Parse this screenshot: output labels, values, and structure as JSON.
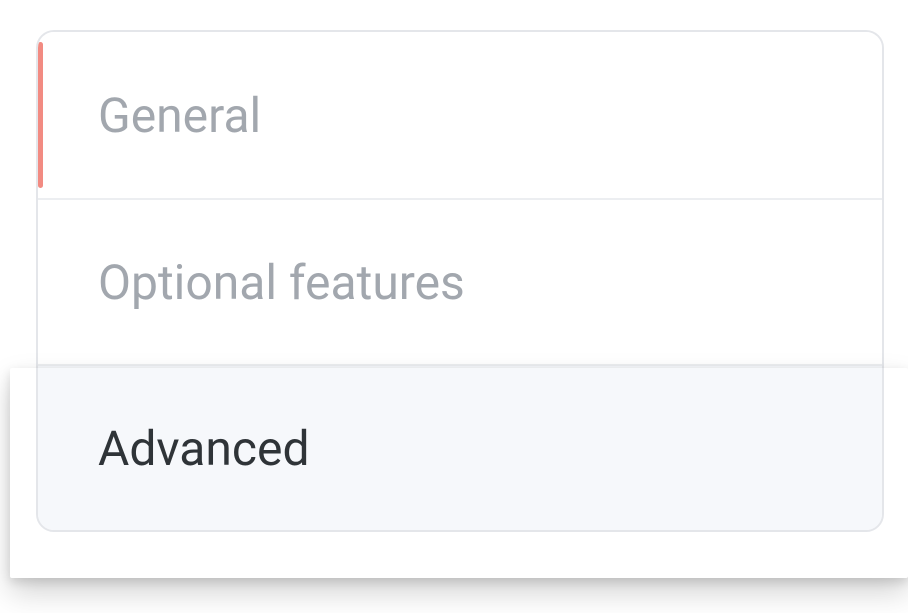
{
  "tabs": [
    {
      "label": "General"
    },
    {
      "label": "Optional features"
    },
    {
      "label": "Advanced"
    }
  ]
}
